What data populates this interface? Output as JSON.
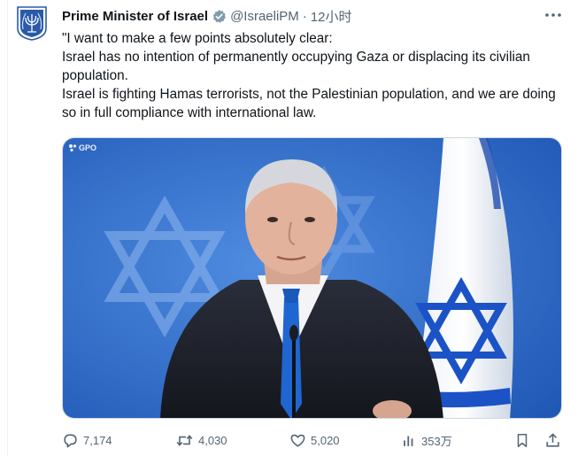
{
  "author": {
    "display_name": "Prime Minister of Israel",
    "handle": "@IsraeliPM",
    "separator": "·",
    "timestamp": "12小时",
    "verified_badge": "verified-badge-icon",
    "avatar": "israel-emblem-icon"
  },
  "tweet": {
    "lines": [
      "\"I want to make a few points absolutely clear:",
      "Israel has no intention of permanently occupying Gaza or displacing its civilian population.",
      "Israel is fighting Hamas terrorists, not the Palestinian population, and we are doing so in full compliance with international law."
    ]
  },
  "media": {
    "watermark": "GPO",
    "description_icon": "video-thumbnail"
  },
  "actions": {
    "replies": "7,174",
    "reposts": "4,030",
    "likes": "5,020",
    "views": "353万",
    "bookmark_icon": "bookmark-icon",
    "share_icon": "share-icon"
  },
  "colors": {
    "text": "#0f1419",
    "muted": "#536471",
    "verified": "#829aab",
    "background_blue": "#2f6fd0",
    "flag_blue": "#0038b8"
  }
}
